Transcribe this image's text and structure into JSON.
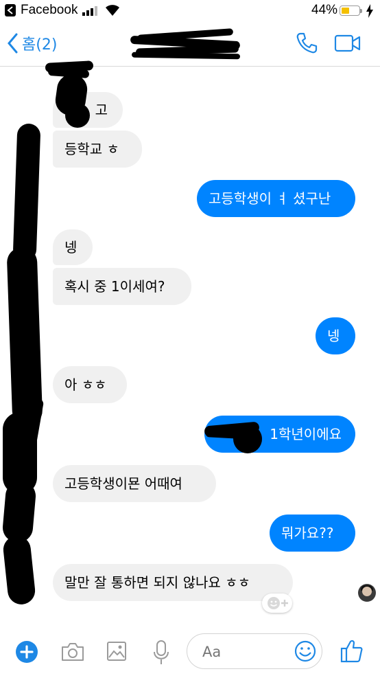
{
  "status_bar": {
    "back_app": "Facebook",
    "battery": "44%",
    "battery_level": 0.44
  },
  "header": {
    "back_label": "홈(2)",
    "contact_name": ""
  },
  "messages": [
    {
      "side": "in",
      "text": "고"
    },
    {
      "side": "in",
      "text": "등학교 ㅎ"
    },
    {
      "side": "out",
      "text": "고등학생이 ㅕ 셨구난"
    },
    {
      "side": "in",
      "text": "넹"
    },
    {
      "side": "in",
      "text": "혹시 중 1이세여?"
    },
    {
      "side": "out",
      "text": "넹"
    },
    {
      "side": "in",
      "text": "아 ㅎㅎ"
    },
    {
      "side": "out",
      "text": "1학년이에요"
    },
    {
      "side": "in",
      "text": "고등학생이묜 어때여"
    },
    {
      "side": "out",
      "text": "뭐가요??"
    },
    {
      "side": "in",
      "text": "말만 잘 통하면 되지 않나요 ㅎㅎ"
    }
  ],
  "composer": {
    "placeholder": "Aa"
  },
  "colors": {
    "accent": "#0084ff",
    "nav_blue": "#1e88e5",
    "incoming_bubble": "#f0f0f0",
    "battery": "#f4c000"
  },
  "icons": {
    "status": [
      "signal-icon",
      "wifi-icon",
      "battery-icon",
      "charging-icon"
    ],
    "header": [
      "chevron-left-icon",
      "phone-icon",
      "video-camera-icon"
    ],
    "composer": [
      "plus-icon",
      "camera-icon",
      "image-icon",
      "microphone-icon",
      "emoji-icon",
      "thumbs-up-icon"
    ]
  }
}
